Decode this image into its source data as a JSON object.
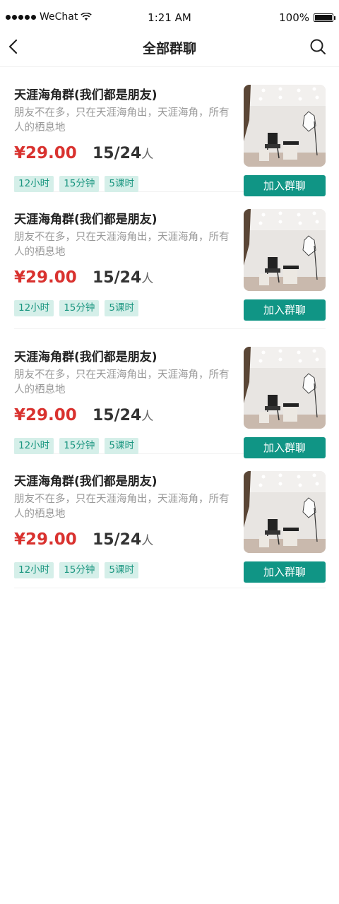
{
  "status_bar": {
    "carrier": "WeChat",
    "time": "1:21 AM",
    "battery": "100%"
  },
  "nav": {
    "title": "全部群聊"
  },
  "groups": [
    {
      "title": "天涯海角群(我们都是朋友)",
      "description": "朋友不在多，只在天涯海角出，天涯海角，所有人的栖息地",
      "price": "¥29.00",
      "members": "15/24",
      "members_unit": "人",
      "tags": [
        "12小时",
        "15分钟",
        "5课时"
      ],
      "join_label": "加入群聊"
    },
    {
      "title": "天涯海角群(我们都是朋友)",
      "description": "朋友不在多，只在天涯海角出，天涯海角，所有人的栖息地",
      "price": "¥29.00",
      "members": "15/24",
      "members_unit": "人",
      "tags": [
        "12小时",
        "15分钟",
        "5课时"
      ],
      "join_label": "加入群聊"
    },
    {
      "title": "天涯海角群(我们都是朋友)",
      "description": "朋友不在多，只在天涯海角出，天涯海角，所有人的栖息地",
      "price": "¥29.00",
      "members": "15/24",
      "members_unit": "人",
      "tags": [
        "12小时",
        "15分钟",
        "5课时"
      ],
      "join_label": "加入群聊"
    },
    {
      "title": "天涯海角群(我们都是朋友)",
      "description": "朋友不在多，只在天涯海角出，天涯海角，所有人的栖息地",
      "price": "¥29.00",
      "members": "15/24",
      "members_unit": "人",
      "tags": [
        "12小时",
        "15分钟",
        "5课时"
      ],
      "join_label": "加入群聊"
    }
  ],
  "colors": {
    "price": "#d9322f",
    "accent": "#109585",
    "tag_bg": "#d5efe9",
    "tag_text": "#1b9680"
  }
}
